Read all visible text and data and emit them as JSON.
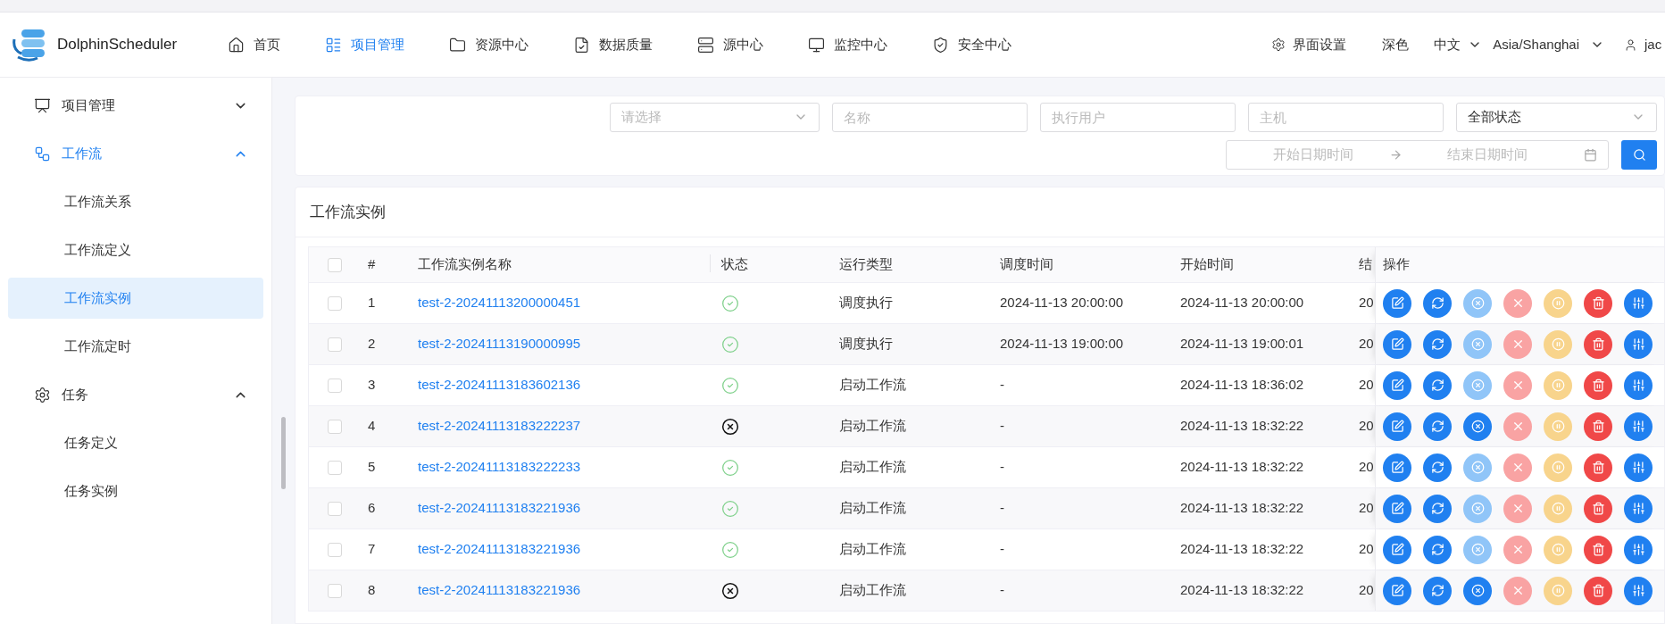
{
  "brand": {
    "name": "DolphinScheduler"
  },
  "nav": [
    {
      "label": "首页",
      "kind": "home",
      "selected": false
    },
    {
      "label": "项目管理",
      "kind": "project",
      "selected": true
    },
    {
      "label": "资源中心",
      "kind": "folder",
      "selected": false
    },
    {
      "label": "数据质量",
      "kind": "quality",
      "selected": false
    },
    {
      "label": "源中心",
      "kind": "datasource",
      "selected": false
    },
    {
      "label": "监控中心",
      "kind": "monitor",
      "selected": false
    },
    {
      "label": "安全中心",
      "kind": "security",
      "selected": false
    }
  ],
  "header_right": {
    "settings": "界面设置",
    "theme": "深色",
    "language": "中文",
    "timezone": "Asia/Shanghai",
    "user": "jac"
  },
  "sidebar": [
    {
      "label": "项目管理",
      "kind": "project",
      "expanded": false,
      "selected": false
    },
    {
      "label": "工作流",
      "kind": "workflow",
      "expanded": true,
      "selected": true,
      "children": [
        {
          "label": "工作流关系",
          "selected": false
        },
        {
          "label": "工作流定义",
          "selected": false
        },
        {
          "label": "工作流实例",
          "selected": true
        },
        {
          "label": "工作流定时",
          "selected": false
        }
      ]
    },
    {
      "label": "任务",
      "kind": "task",
      "expanded": true,
      "selected": false,
      "children": [
        {
          "label": "任务定义",
          "selected": false
        },
        {
          "label": "任务实例",
          "selected": false
        }
      ]
    }
  ],
  "filters": {
    "project_select": {
      "placeholder": "请选择"
    },
    "name": {
      "placeholder": "名称"
    },
    "executor": {
      "placeholder": "执行用户"
    },
    "host": {
      "placeholder": "主机"
    },
    "state_select": {
      "value": "全部状态"
    },
    "date_range": {
      "start_placeholder": "开始日期时间",
      "end_placeholder": "结束日期时间"
    }
  },
  "table": {
    "title": "工作流实例",
    "all_checked": false,
    "columns": [
      "#",
      "工作流实例名称",
      "状态",
      "运行类型",
      "调度时间",
      "开始时间",
      "结",
      "操作"
    ],
    "rows": [
      {
        "checked": false,
        "index": "1",
        "name": "test-2-20241113200000451",
        "failed": false,
        "run_type": "调度执行",
        "schedule_time": "2024-11-13 20:00:00",
        "start_time": "2024-11-13 20:00:00",
        "column_7": "20",
        "actions": [
          {
            "kind": "edit",
            "disabled": false
          },
          {
            "kind": "rerun",
            "disabled": false
          },
          {
            "kind": "stop",
            "disabled": true
          },
          {
            "kind": "cancel",
            "disabled": true
          },
          {
            "kind": "pause",
            "disabled": true
          },
          {
            "kind": "delete",
            "disabled": false
          },
          {
            "kind": "gantt",
            "disabled": false
          }
        ]
      },
      {
        "checked": false,
        "index": "2",
        "name": "test-2-20241113190000995",
        "failed": false,
        "run_type": "调度执行",
        "schedule_time": "2024-11-13 19:00:00",
        "start_time": "2024-11-13 19:00:01",
        "column_7": "20",
        "actions": [
          {
            "kind": "edit",
            "disabled": false
          },
          {
            "kind": "rerun",
            "disabled": false
          },
          {
            "kind": "stop",
            "disabled": true
          },
          {
            "kind": "cancel",
            "disabled": true
          },
          {
            "kind": "pause",
            "disabled": true
          },
          {
            "kind": "delete",
            "disabled": false
          },
          {
            "kind": "gantt",
            "disabled": false
          }
        ]
      },
      {
        "checked": false,
        "index": "3",
        "name": "test-2-20241113183602136",
        "failed": false,
        "run_type": "启动工作流",
        "schedule_time": "-",
        "start_time": "2024-11-13 18:36:02",
        "column_7": "20",
        "actions": [
          {
            "kind": "edit",
            "disabled": false
          },
          {
            "kind": "rerun",
            "disabled": false
          },
          {
            "kind": "stop",
            "disabled": true
          },
          {
            "kind": "cancel",
            "disabled": true
          },
          {
            "kind": "pause",
            "disabled": true
          },
          {
            "kind": "delete",
            "disabled": false
          },
          {
            "kind": "gantt",
            "disabled": false
          }
        ]
      },
      {
        "checked": false,
        "index": "4",
        "name": "test-2-20241113183222237",
        "failed": true,
        "run_type": "启动工作流",
        "schedule_time": "-",
        "start_time": "2024-11-13 18:32:22",
        "column_7": "20",
        "actions": [
          {
            "kind": "edit",
            "disabled": false
          },
          {
            "kind": "rerun",
            "disabled": false
          },
          {
            "kind": "stop",
            "disabled": false
          },
          {
            "kind": "cancel",
            "disabled": true
          },
          {
            "kind": "pause",
            "disabled": true
          },
          {
            "kind": "delete",
            "disabled": false
          },
          {
            "kind": "gantt",
            "disabled": false
          }
        ]
      },
      {
        "checked": false,
        "index": "5",
        "name": "test-2-20241113183222233",
        "failed": false,
        "run_type": "启动工作流",
        "schedule_time": "-",
        "start_time": "2024-11-13 18:32:22",
        "column_7": "20",
        "actions": [
          {
            "kind": "edit",
            "disabled": false
          },
          {
            "kind": "rerun",
            "disabled": false
          },
          {
            "kind": "stop",
            "disabled": true
          },
          {
            "kind": "cancel",
            "disabled": true
          },
          {
            "kind": "pause",
            "disabled": true
          },
          {
            "kind": "delete",
            "disabled": false
          },
          {
            "kind": "gantt",
            "disabled": false
          }
        ]
      },
      {
        "checked": false,
        "index": "6",
        "name": "test-2-20241113183221936",
        "failed": false,
        "run_type": "启动工作流",
        "schedule_time": "-",
        "start_time": "2024-11-13 18:32:22",
        "column_7": "20",
        "actions": [
          {
            "kind": "edit",
            "disabled": false
          },
          {
            "kind": "rerun",
            "disabled": false
          },
          {
            "kind": "stop",
            "disabled": true
          },
          {
            "kind": "cancel",
            "disabled": true
          },
          {
            "kind": "pause",
            "disabled": true
          },
          {
            "kind": "delete",
            "disabled": false
          },
          {
            "kind": "gantt",
            "disabled": false
          }
        ]
      },
      {
        "checked": false,
        "index": "7",
        "name": "test-2-20241113183221936",
        "failed": false,
        "run_type": "启动工作流",
        "schedule_time": "-",
        "start_time": "2024-11-13 18:32:22",
        "column_7": "20",
        "actions": [
          {
            "kind": "edit",
            "disabled": false
          },
          {
            "kind": "rerun",
            "disabled": false
          },
          {
            "kind": "stop",
            "disabled": true
          },
          {
            "kind": "cancel",
            "disabled": true
          },
          {
            "kind": "pause",
            "disabled": true
          },
          {
            "kind": "delete",
            "disabled": false
          },
          {
            "kind": "gantt",
            "disabled": false
          }
        ]
      },
      {
        "checked": false,
        "index": "8",
        "name": "test-2-20241113183221936",
        "failed": true,
        "run_type": "启动工作流",
        "schedule_time": "-",
        "start_time": "2024-11-13 18:32:22",
        "column_7": "20",
        "actions": [
          {
            "kind": "edit",
            "disabled": false
          },
          {
            "kind": "rerun",
            "disabled": false
          },
          {
            "kind": "stop",
            "disabled": false
          },
          {
            "kind": "cancel",
            "disabled": true
          },
          {
            "kind": "pause",
            "disabled": true
          },
          {
            "kind": "delete",
            "disabled": false
          },
          {
            "kind": "gantt",
            "disabled": false
          }
        ]
      }
    ]
  }
}
